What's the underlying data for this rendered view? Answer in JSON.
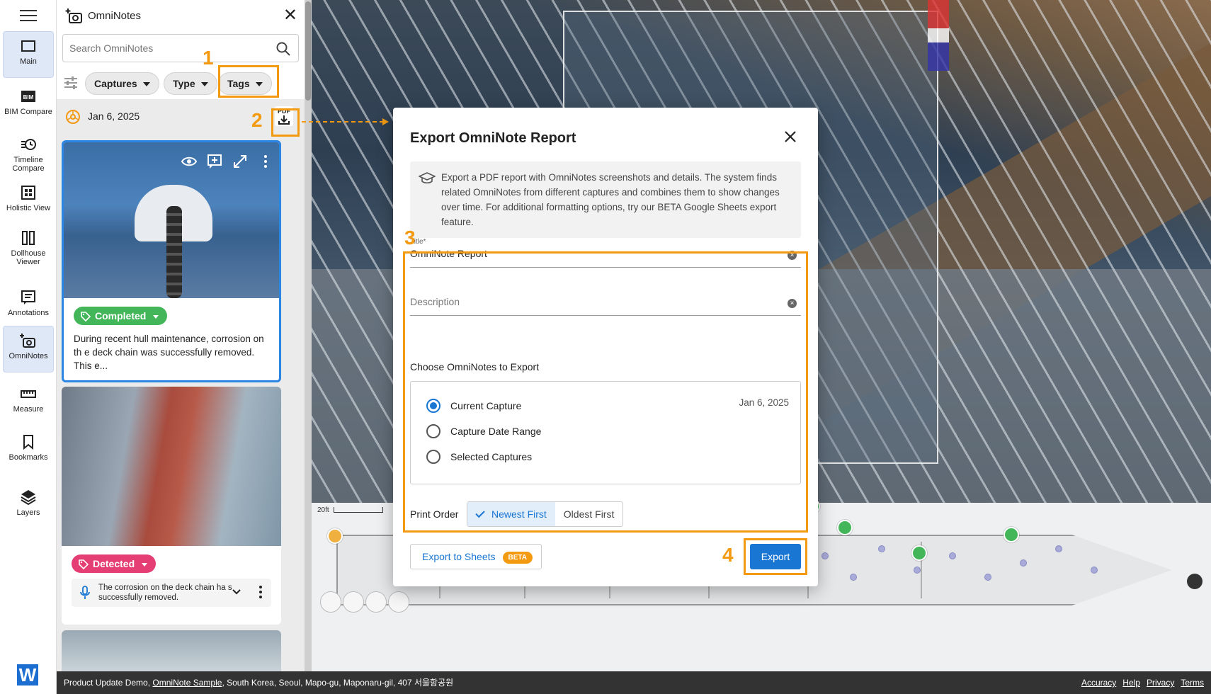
{
  "rail": {
    "items": [
      {
        "label": "Main"
      },
      {
        "label": "BIM Compare"
      },
      {
        "label": "Timeline Compare"
      },
      {
        "label": "Holistic View"
      },
      {
        "label": "Dollhouse Viewer"
      },
      {
        "label": "Annotations"
      },
      {
        "label": "OmniNotes"
      },
      {
        "label": "Measure"
      },
      {
        "label": "Bookmarks"
      },
      {
        "label": "Layers"
      }
    ],
    "bim_badge": "BIM",
    "logo": "W"
  },
  "panel": {
    "title": "OmniNotes",
    "search_placeholder": "Search OmniNotes",
    "filters": [
      "Captures",
      "Type",
      "Tags"
    ],
    "date": "Jan 6, 2025",
    "pdf_label": "PDF",
    "cards": [
      {
        "tag": "Completed",
        "description": "During recent hull maintenance, corrosion on th e deck chain was successfully removed. This e..."
      },
      {
        "tag": "Detected",
        "voice_text": "The corrosion on the deck chain ha s successfully removed."
      }
    ]
  },
  "steps": [
    "1",
    "2",
    "3",
    "4"
  ],
  "scale_label": "20ft",
  "modal": {
    "title": "Export OmniNote Report",
    "info": "Export a PDF report with OmniNotes screenshots and details. The system finds related OmniNotes from different captures and combines them to show changes over time. For additional formatting options, try our BETA Google Sheets export feature.",
    "title_label": "Title*",
    "title_value": "OmniNote Report",
    "description_placeholder": "Description",
    "choose_label": "Choose OmniNotes to Export",
    "options": [
      {
        "label": "Current Capture",
        "selected": true
      },
      {
        "label": "Capture Date Range",
        "selected": false
      },
      {
        "label": "Selected Captures",
        "selected": false
      }
    ],
    "current_capture_date": "Jan 6, 2025",
    "print_order_label": "Print Order",
    "print_order_options": [
      "Newest First",
      "Oldest First"
    ],
    "print_order_selected": "Newest First",
    "sheets_button": "Export to Sheets",
    "beta_badge": "BETA",
    "export_button": "Export"
  },
  "footer": {
    "prefix": "Product Update Demo, ",
    "link": "OmniNote Sample",
    "address": ", South Korea, Seoul, Mapo-gu, Maponaru-gil, 407 서울함공원",
    "links": [
      "Accuracy",
      "Help",
      "Privacy",
      "Terms"
    ]
  },
  "colors": {
    "accent": "#1976d2",
    "highlight": "#f39a11",
    "tag_completed": "#43b65a",
    "tag_detected": "#e53e74"
  }
}
